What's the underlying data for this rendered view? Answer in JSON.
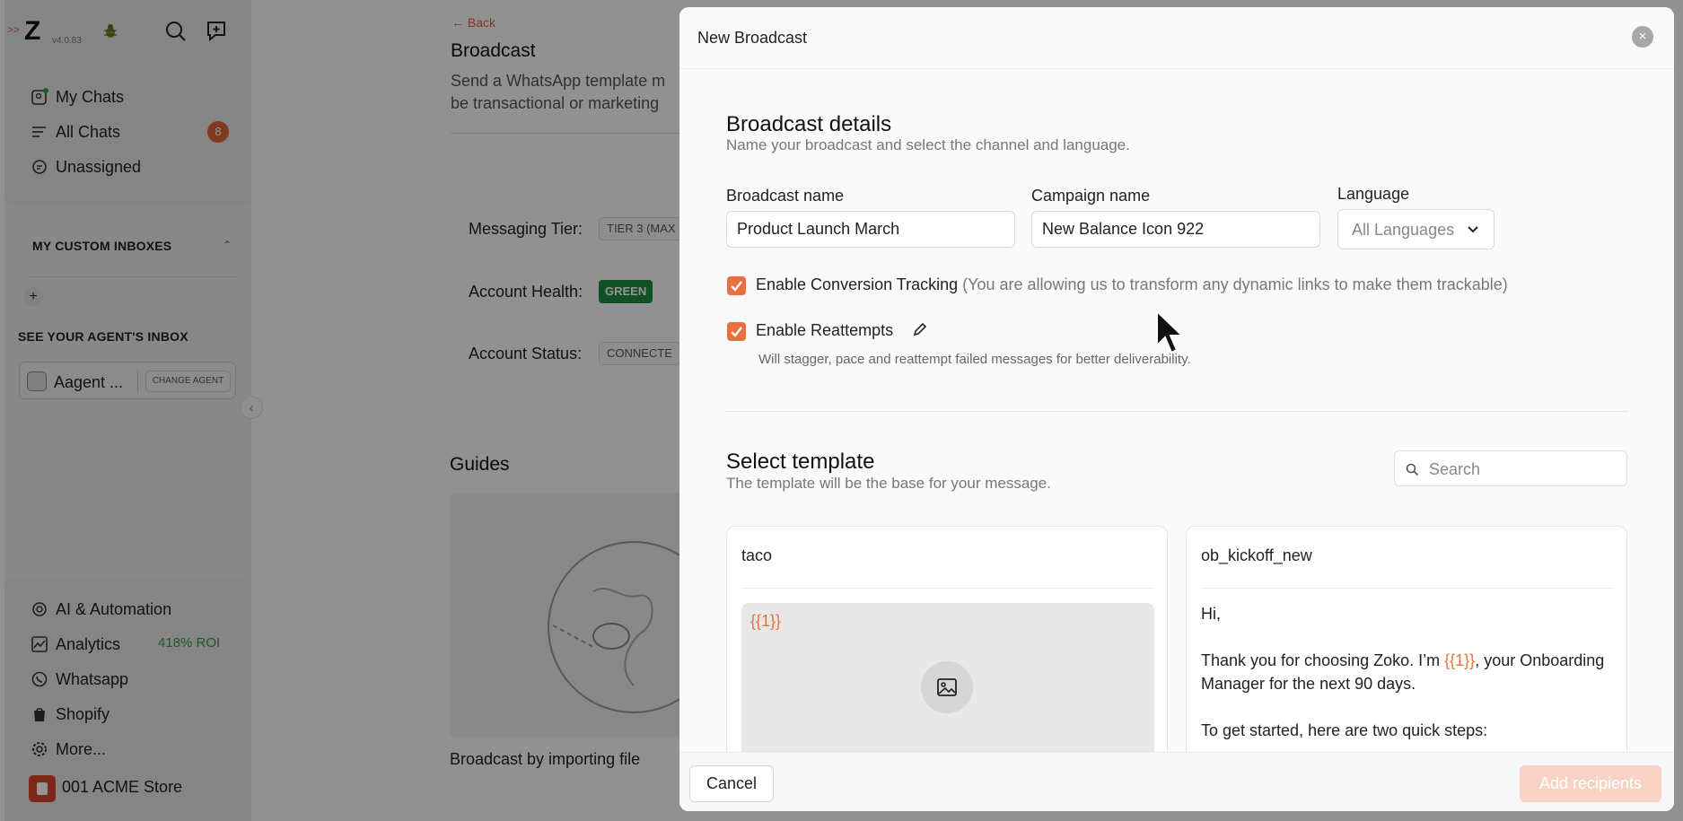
{
  "sidebar": {
    "version": "v4.0.83",
    "nav": [
      {
        "label": "My Chats",
        "icon": "chat-bubble-icon"
      },
      {
        "label": "All Chats",
        "icon": "list-icon"
      },
      {
        "label": "Unassigned",
        "icon": "message-icon"
      }
    ],
    "all_chats_count": "8",
    "custom_inboxes_title": "MY CUSTOM INBOXES",
    "agent_inbox_title": "SEE YOUR AGENT'S INBOX",
    "agent_name": "Aagent ...",
    "change_agent_label": "CHANGE AGENT",
    "bottom": [
      {
        "label": "AI & Automation",
        "icon": "openai-icon"
      },
      {
        "label": "Analytics",
        "icon": "chart-icon"
      },
      {
        "label": "Whatsapp",
        "icon": "whatsapp-icon"
      },
      {
        "label": "Shopify",
        "icon": "shopify-icon"
      },
      {
        "label": "More...",
        "icon": "settings-icon"
      }
    ],
    "roi": "418% ROI",
    "store_name": "001 ACME Store"
  },
  "main": {
    "back_label": "Back",
    "title": "Broadcast",
    "description": "Send a WhatsApp template m be transactional or marketing",
    "messaging_tier_label": "Messaging Tier:",
    "messaging_tier_value": "TIER 3 (MAX",
    "account_health_label": "Account Health:",
    "account_health_value": "GREEN",
    "account_status_label": "Account Status:",
    "account_status_value": "CONNECTE",
    "guides_title": "Guides",
    "guide_caption": "Broadcast by importing file"
  },
  "modal": {
    "title": "New Broadcast",
    "details_title": "Broadcast details",
    "details_subtitle": "Name your broadcast and select the channel and language.",
    "broadcast_name_label": "Broadcast name",
    "broadcast_name_value": "Product Launch March",
    "campaign_name_label": "Campaign name",
    "campaign_name_value": "New Balance Icon 922",
    "language_label": "Language",
    "language_value": "All Languages",
    "conversion_label": "Enable Conversion Tracking",
    "conversion_note": "(You are allowing us to transform any dynamic links to make them trackable)",
    "reattempts_label": "Enable Reattempts",
    "reattempts_help": "Will stagger, pace and reattempt failed messages for better deliverability.",
    "template_title": "Select template",
    "template_subtitle": "The template will be the base for your message.",
    "search_placeholder": "Search",
    "templates": [
      {
        "name": "taco",
        "variable": "{{1}}"
      },
      {
        "name": "ob_kickoff_new",
        "line1": "Hi,",
        "line2_pre": "Thank you for choosing Zoko. I’m ",
        "line2_var": "{{1}}",
        "line2_post": ", your Onboarding Manager for the next 90 days.",
        "line3": "To get started, here are two quick steps:"
      }
    ],
    "cancel_label": "Cancel",
    "add_recipients_label": "Add recipients"
  },
  "colors": {
    "accent": "#e8703f",
    "green": "#1c8a3f",
    "badge": "#e0623a"
  }
}
